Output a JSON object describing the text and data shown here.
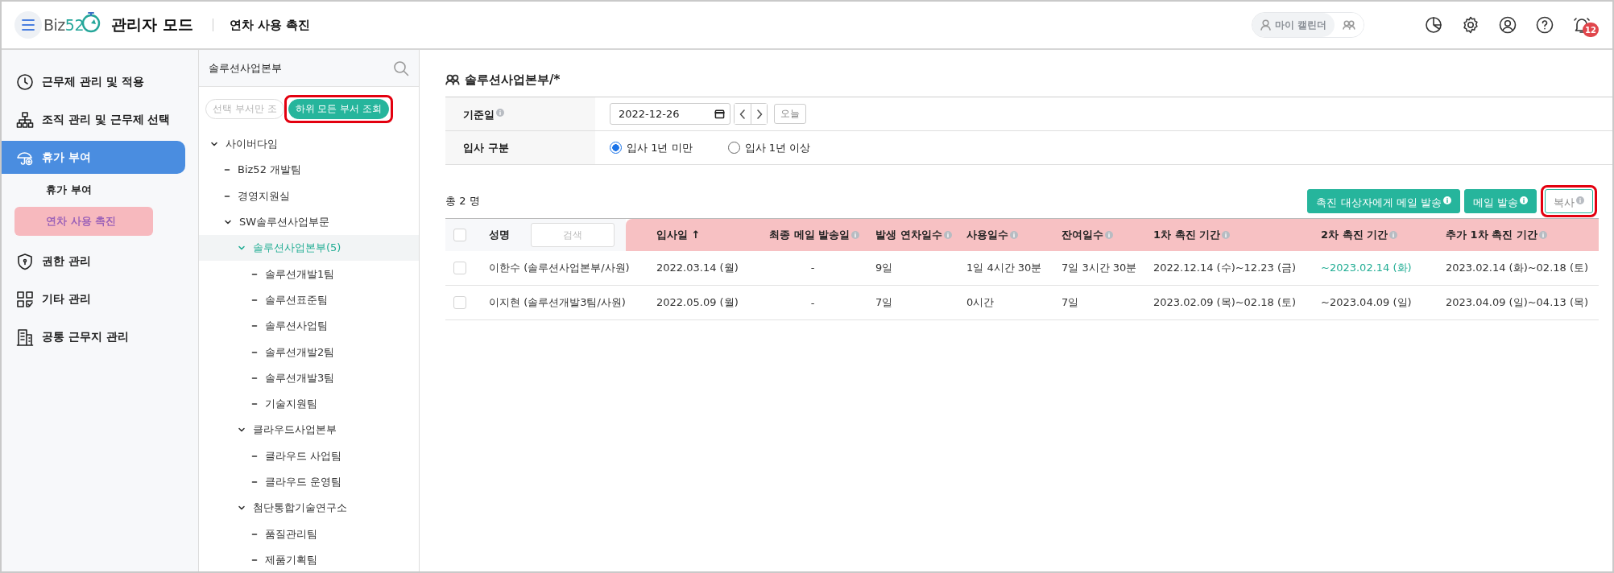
{
  "header": {
    "logo_text": "Biz",
    "logo_accent": "52",
    "mode_title": "관리자 모드",
    "page_title": "연차 사용 촉진",
    "calendar_views": [
      {
        "label": "마이 캘린더",
        "selected": true
      },
      {
        "selected": false
      }
    ],
    "notification_count": "12"
  },
  "sidebar": {
    "items": [
      {
        "label": "근무제 관리 및 적용",
        "selected": false
      },
      {
        "label": "조직 관리 및 근무제 선택",
        "selected": false
      },
      {
        "label": "휴가 부여",
        "selected": true,
        "children": [
          {
            "label": "휴가 부여",
            "selected": false
          },
          {
            "label": "연차 사용 촉진",
            "selected": true
          }
        ]
      },
      {
        "label": "권한 관리",
        "selected": false
      },
      {
        "label": "기타 관리",
        "selected": false
      },
      {
        "label": "공통 근무지 관리",
        "selected": false
      }
    ]
  },
  "org_tree": {
    "title": "솔루션사업본부",
    "scope_buttons": [
      {
        "label": "선택 부서만 조",
        "selected": false,
        "highlighted": false
      },
      {
        "label": "하위 모든 부서 조회",
        "selected": true,
        "highlighted": true
      }
    ],
    "nodes": [
      {
        "label": "사이버다임",
        "expanded": true,
        "selected": false,
        "children": [
          {
            "label": "Biz52 개발팀",
            "selected": false
          },
          {
            "label": "경영지원실",
            "selected": false
          },
          {
            "label": "SW솔루션사업부문",
            "expanded": true,
            "selected": false,
            "children": [
              {
                "label": "솔루션사업본부(5)",
                "expanded": true,
                "selected": true,
                "children": [
                  {
                    "label": "솔루션개발1팀",
                    "selected": false
                  },
                  {
                    "label": "솔루션표준팀",
                    "selected": false
                  },
                  {
                    "label": "솔루션사업팀",
                    "selected": false
                  },
                  {
                    "label": "솔루션개발2팀",
                    "selected": false
                  },
                  {
                    "label": "솔루션개발3팀",
                    "selected": false
                  },
                  {
                    "label": "기술지원팀",
                    "selected": false
                  }
                ]
              },
              {
                "label": "클라우드사업본부",
                "expanded": true,
                "selected": false,
                "children": [
                  {
                    "label": "클라우드 사업팀",
                    "selected": false
                  },
                  {
                    "label": "클라우드 운영팀",
                    "selected": false
                  }
                ]
              },
              {
                "label": "첨단통합기술연구소",
                "expanded": true,
                "selected": false,
                "children": [
                  {
                    "label": "품질관리팀",
                    "selected": false
                  },
                  {
                    "label": "제품기획팀",
                    "selected": false
                  }
                ]
              }
            ]
          }
        ]
      }
    ]
  },
  "main": {
    "title": "솔루션사업본부/*",
    "filters": {
      "base_date": {
        "label": "기준일",
        "info": true,
        "value": "2022-12-26",
        "today_button": "오늘"
      },
      "hire_type": {
        "label": "입사 구분",
        "options": [
          {
            "label": "입사 1년 미만",
            "selected": true
          },
          {
            "label": "입사 1년 이상",
            "selected": false
          }
        ]
      }
    },
    "total": "총 2 명",
    "buttons": [
      {
        "label": "촉진 대상자에게 메일 발송",
        "kind": "primary",
        "info": true,
        "highlighted": false
      },
      {
        "label": "메일 발송",
        "kind": "primary",
        "info": true,
        "highlighted": false
      },
      {
        "label": "복사",
        "kind": "outline",
        "info": true,
        "highlighted": true
      }
    ],
    "table": {
      "select_all": {
        "checked": false
      },
      "columns": [
        {
          "label": "성명",
          "info": false,
          "highlighted": false,
          "search_placeholder": "검색"
        },
        {
          "label": "입사일 ↑",
          "info": false,
          "highlighted": true
        },
        {
          "label": "최종 메일 발송일",
          "info": true,
          "highlighted": true
        },
        {
          "label": "발생 연차일수",
          "info": true,
          "highlighted": true
        },
        {
          "label": "사용일수",
          "info": true,
          "highlighted": true
        },
        {
          "label": "잔여일수",
          "info": true,
          "highlighted": true
        },
        {
          "label": "1차 촉진 기간",
          "info": true,
          "highlighted": true
        },
        {
          "label": "2차 촉진 기간",
          "info": true,
          "highlighted": true
        },
        {
          "label": "추가 1차 촉진 기간",
          "info": true,
          "highlighted": true
        }
      ],
      "rows": [
        {
          "checked": false,
          "cells": [
            "이한수 (솔루션사업본부/사원)",
            "2022.03.14 (월)",
            "-",
            "9일",
            "1일 4시간 30분",
            "7일 3시간 30분",
            "2022.12.14 (수)~12.23 (금)",
            {
              "text": "~2023.02.14 (화)",
              "accent": true
            },
            "2023.02.14 (화)~02.18 (토)"
          ]
        },
        {
          "checked": false,
          "cells": [
            "이지현 (솔루션개발3팀/사원)",
            "2022.05.09 (월)",
            "-",
            "7일",
            "0시간",
            "7일",
            "2023.02.09 (목)~02.18 (토)",
            "~2023.04.09 (일)",
            "2023.04.09 (일)~04.13 (목)"
          ]
        }
      ]
    }
  }
}
